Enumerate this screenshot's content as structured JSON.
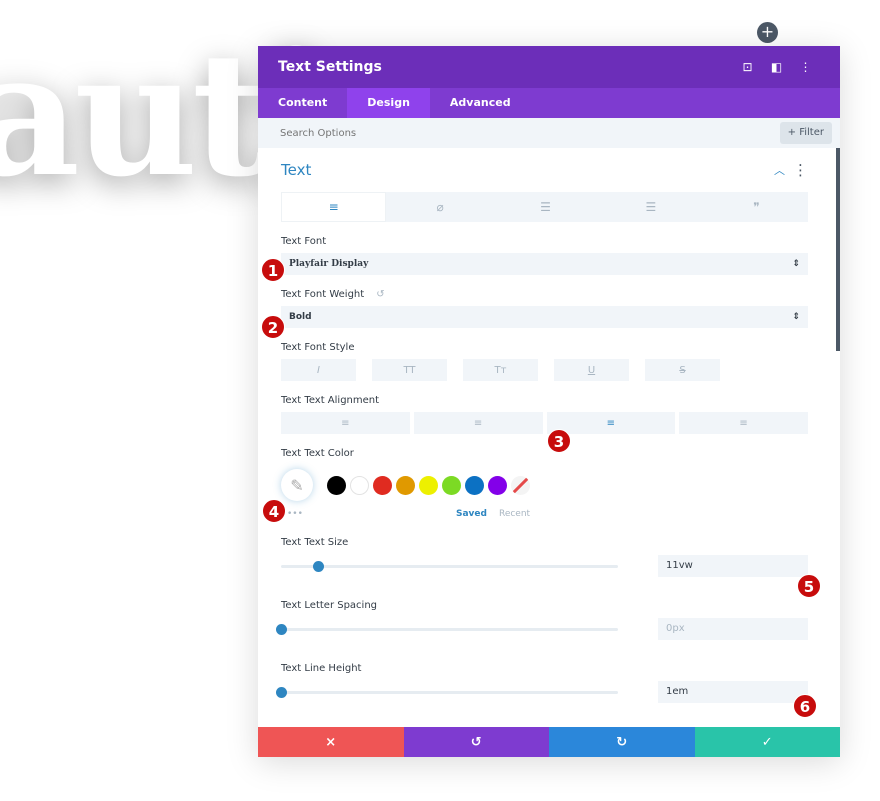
{
  "background_text": "auti",
  "modal": {
    "title": "Text Settings",
    "header_icons": [
      "focus-icon",
      "split-view-icon",
      "more-icon"
    ],
    "tabs": [
      {
        "label": "Content"
      },
      {
        "label": "Design",
        "active": true
      },
      {
        "label": "Advanced"
      }
    ],
    "search_placeholder": "Search Options",
    "filter_label": "+ Filter",
    "section_title": "Text",
    "subtabs": [
      "text-align-icon",
      "link-icon",
      "unordered-list-icon",
      "ordered-list-icon",
      "quote-icon"
    ],
    "font": {
      "label": "Text Font",
      "value": "Playfair Display"
    },
    "weight": {
      "label": "Text Font Weight",
      "value": "Bold"
    },
    "style": {
      "label": "Text Font Style",
      "buttons": [
        "I",
        "TT",
        "Tт",
        "U",
        "S"
      ]
    },
    "alignment": {
      "label": "Text Text Alignment",
      "options": [
        "left",
        "center",
        "right",
        "justify"
      ],
      "selected": "right"
    },
    "color": {
      "label": "Text Text Color",
      "swatches": [
        "#000000",
        "#ffffff",
        "#e02b20",
        "#e09900",
        "#edf000",
        "#7cda24",
        "#0c71c3",
        "#8300e9"
      ],
      "more": "•••",
      "saved": "Saved",
      "recent": "Recent"
    },
    "size": {
      "label": "Text Text Size",
      "value": "11vw",
      "slider_percent": 11
    },
    "letter_spacing": {
      "label": "Text Letter Spacing",
      "value": "0px",
      "slider_percent": 0
    },
    "line_height": {
      "label": "Text Line Height",
      "value": "1em",
      "slider_percent": 0
    }
  },
  "footer": {
    "colors": [
      "#ef5555",
      "#7e3bd0",
      "#2b87da",
      "#29c4a9"
    ],
    "icons": [
      "×",
      "↺",
      "↻",
      "✓"
    ]
  },
  "badges": [
    "1",
    "2",
    "3",
    "4",
    "5",
    "6"
  ],
  "colors": {
    "header": "#6c2eb9",
    "tabs": "#7e3bd0",
    "accent": "#2e86c1"
  }
}
